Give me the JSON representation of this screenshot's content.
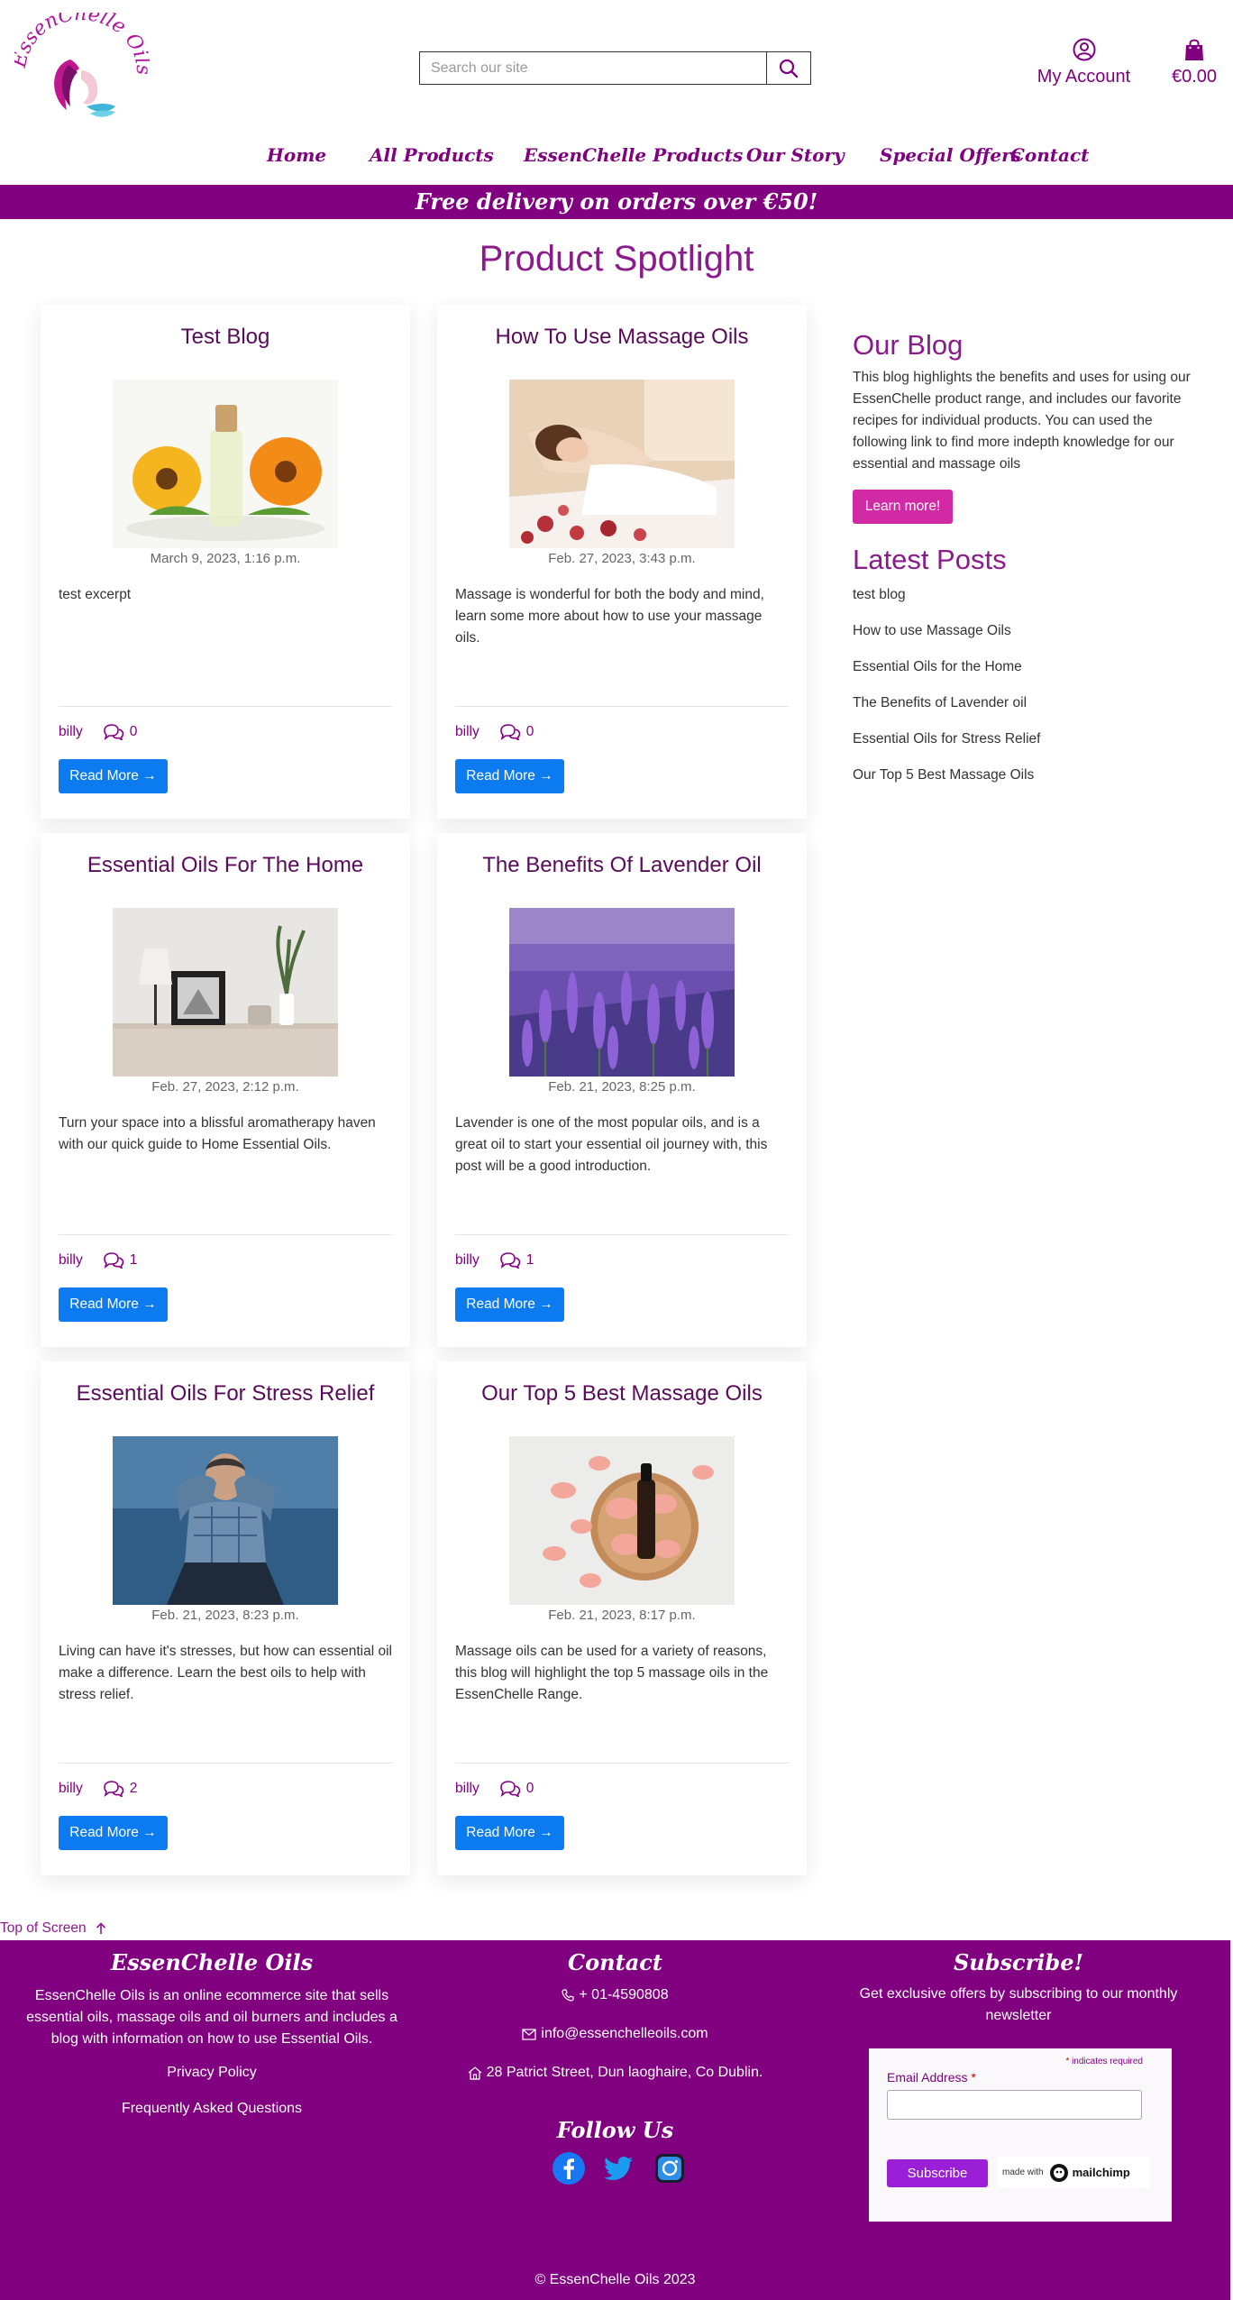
{
  "brand": {
    "name": "EssenChelle Oils"
  },
  "search": {
    "placeholder": "Search our site"
  },
  "header": {
    "account_label": "My Account",
    "cart_total": "€0.00"
  },
  "nav": {
    "items": [
      "Home",
      "All Products",
      "EssenChelle Products",
      "Our Story",
      "Special Offers",
      "Contact"
    ]
  },
  "banner": {
    "text": "Free delivery on orders over €50!"
  },
  "page": {
    "title": "Product Spotlight"
  },
  "posts": [
    {
      "title": "Test Blog",
      "date": "March 9, 2023, 1:16 p.m.",
      "excerpt": "test excerpt",
      "author": "billy",
      "comments": "0",
      "read_more": "Read More →"
    },
    {
      "title": "How To Use Massage Oils",
      "date": "Feb. 27, 2023, 3:43 p.m.",
      "excerpt": "Massage is wonderful for both the body and mind, learn some more about how to use your massage oils.",
      "author": "billy",
      "comments": "0",
      "read_more": "Read More →"
    },
    {
      "title": "Essential Oils For The Home",
      "date": "Feb. 27, 2023, 2:12 p.m.",
      "excerpt": "Turn your space into a blissful aromatherapy haven with our quick guide to Home Essential Oils.",
      "author": "billy",
      "comments": "1",
      "read_more": "Read More →"
    },
    {
      "title": "The Benefits Of Lavender Oil",
      "date": "Feb. 21, 2023, 8:25 p.m.",
      "excerpt": "Lavender is one of the most popular oils, and is a great oil to start your essential oil journey with, this post will be a good introduction.",
      "author": "billy",
      "comments": "1",
      "read_more": "Read More →"
    },
    {
      "title": "Essential Oils For Stress Relief",
      "date": "Feb. 21, 2023, 8:23 p.m.",
      "excerpt": "Living can have it's stresses, but how can essential oil make a difference. Learn the best oils to help with stress relief.",
      "author": "billy",
      "comments": "2",
      "read_more": "Read More →"
    },
    {
      "title": "Our Top 5 Best Massage Oils",
      "date": "Feb. 21, 2023, 8:17 p.m.",
      "excerpt": "Massage oils can be used for a variety of reasons, this blog will highlight the top 5 massage oils in the EssenChelle Range.",
      "author": "billy",
      "comments": "0",
      "read_more": "Read More →"
    }
  ],
  "sidebar": {
    "blog_heading": "Our Blog",
    "blog_intro": "This blog highlights the benefits and uses for using our EssenChelle product range, and includes our favorite recipes for individual products. You can used the following link to find more indepth knowledge for our essential and massage oils",
    "learn_more": "Learn more!",
    "latest_heading": "Latest Posts",
    "latest": [
      "test blog",
      "How to use Massage Oils",
      "Essential Oils for the Home",
      "The Benefits of Lavender oil",
      "Essential Oils for Stress Relief",
      "Our Top 5 Best Massage Oils"
    ]
  },
  "top_link": "Top of Screen",
  "footer": {
    "about_heading": "EssenChelle Oils",
    "about_text": "EssenChelle Oils is an online ecommerce site that sells essential oils, massage oils and oil burners and includes a blog with information on how to use Essential Oils.",
    "privacy": "Privacy Policy",
    "faq": "Frequently Asked Questions",
    "contact_heading": "Contact",
    "phone": "+ 01-4590808",
    "email": "info@essenchelleoils.com",
    "address": "28 Patrict Street, Dun laoghaire, Co Dublin.",
    "follow_heading": "Follow Us",
    "subscribe_heading": "Subscribe!",
    "subscribe_text": "Get exclusive offers by subscribing to our monthly newsletter",
    "required_note": "indicates required",
    "email_label": "Email Address",
    "subscribe_button": "Subscribe",
    "made_with": "made with",
    "mailchimp": "mailchimp",
    "copyright": "© EssenChelle Oils 2023"
  },
  "colors": {
    "brand_purple": "#800080",
    "accent_pink": "#d22aa5",
    "button_blue": "#0d7bf0",
    "subscribe_violet": "#9b1fd6"
  },
  "icons": {
    "search": "search-icon",
    "account": "user-circle-icon",
    "cart": "shopping-bag-icon",
    "comments": "comments-icon",
    "top": "arrow-up-icon",
    "phone": "phone-icon",
    "email": "envelope-icon",
    "address": "home-icon",
    "facebook": "facebook-icon",
    "twitter": "twitter-icon",
    "instagram": "instagram-icon"
  }
}
